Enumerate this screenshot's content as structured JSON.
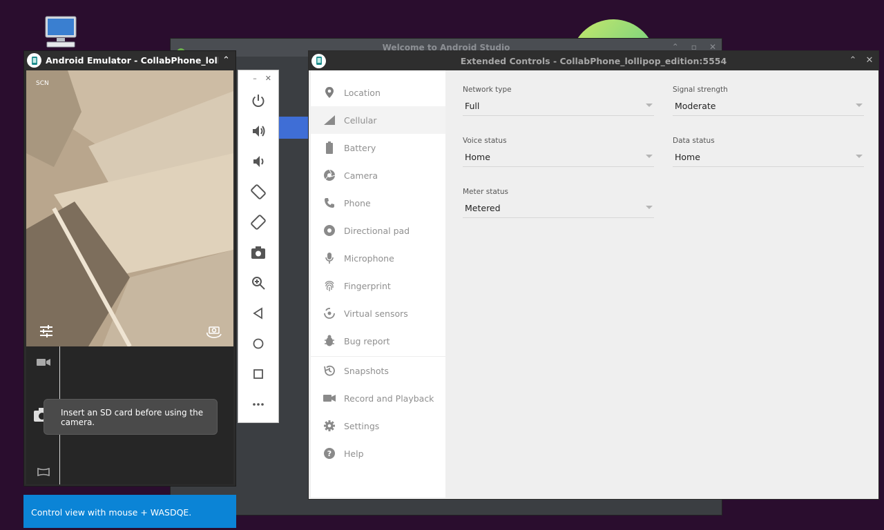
{
  "welcome_window": {
    "title": "Welcome to Android Studio"
  },
  "emulator": {
    "title": "Android Emulator - CollabPhone_lollipop_ec",
    "scene_label": "SCN",
    "toast": "Insert an SD card before using the camera.",
    "banner": "Control view with mouse + WASDQE."
  },
  "extended_controls": {
    "title": "Extended Controls - CollabPhone_lollipop_edition:5554",
    "nav": [
      {
        "label": "Location",
        "icon": "location-pin-icon"
      },
      {
        "label": "Cellular",
        "icon": "signal-icon",
        "selected": true
      },
      {
        "label": "Battery",
        "icon": "battery-icon"
      },
      {
        "label": "Camera",
        "icon": "aperture-icon"
      },
      {
        "label": "Phone",
        "icon": "phone-icon"
      },
      {
        "label": "Directional pad",
        "icon": "dpad-icon"
      },
      {
        "label": "Microphone",
        "icon": "microphone-icon"
      },
      {
        "label": "Fingerprint",
        "icon": "fingerprint-icon"
      },
      {
        "label": "Virtual sensors",
        "icon": "sensors-icon"
      },
      {
        "label": "Bug report",
        "icon": "bug-icon"
      },
      {
        "label": "Snapshots",
        "icon": "history-icon"
      },
      {
        "label": "Record and Playback",
        "icon": "videocam-icon"
      },
      {
        "label": "Settings",
        "icon": "gear-icon"
      },
      {
        "label": "Help",
        "icon": "help-icon"
      }
    ],
    "cellular": {
      "network_type": {
        "label": "Network type",
        "value": "Full"
      },
      "signal_strength": {
        "label": "Signal strength",
        "value": "Moderate"
      },
      "voice_status": {
        "label": "Voice status",
        "value": "Home"
      },
      "data_status": {
        "label": "Data status",
        "value": "Home"
      },
      "meter_status": {
        "label": "Meter status",
        "value": "Metered"
      }
    }
  },
  "colors": {
    "banner": "#0b84d6",
    "desktop": "#2a0d2e",
    "selected_bg": "#f3f3f3"
  }
}
